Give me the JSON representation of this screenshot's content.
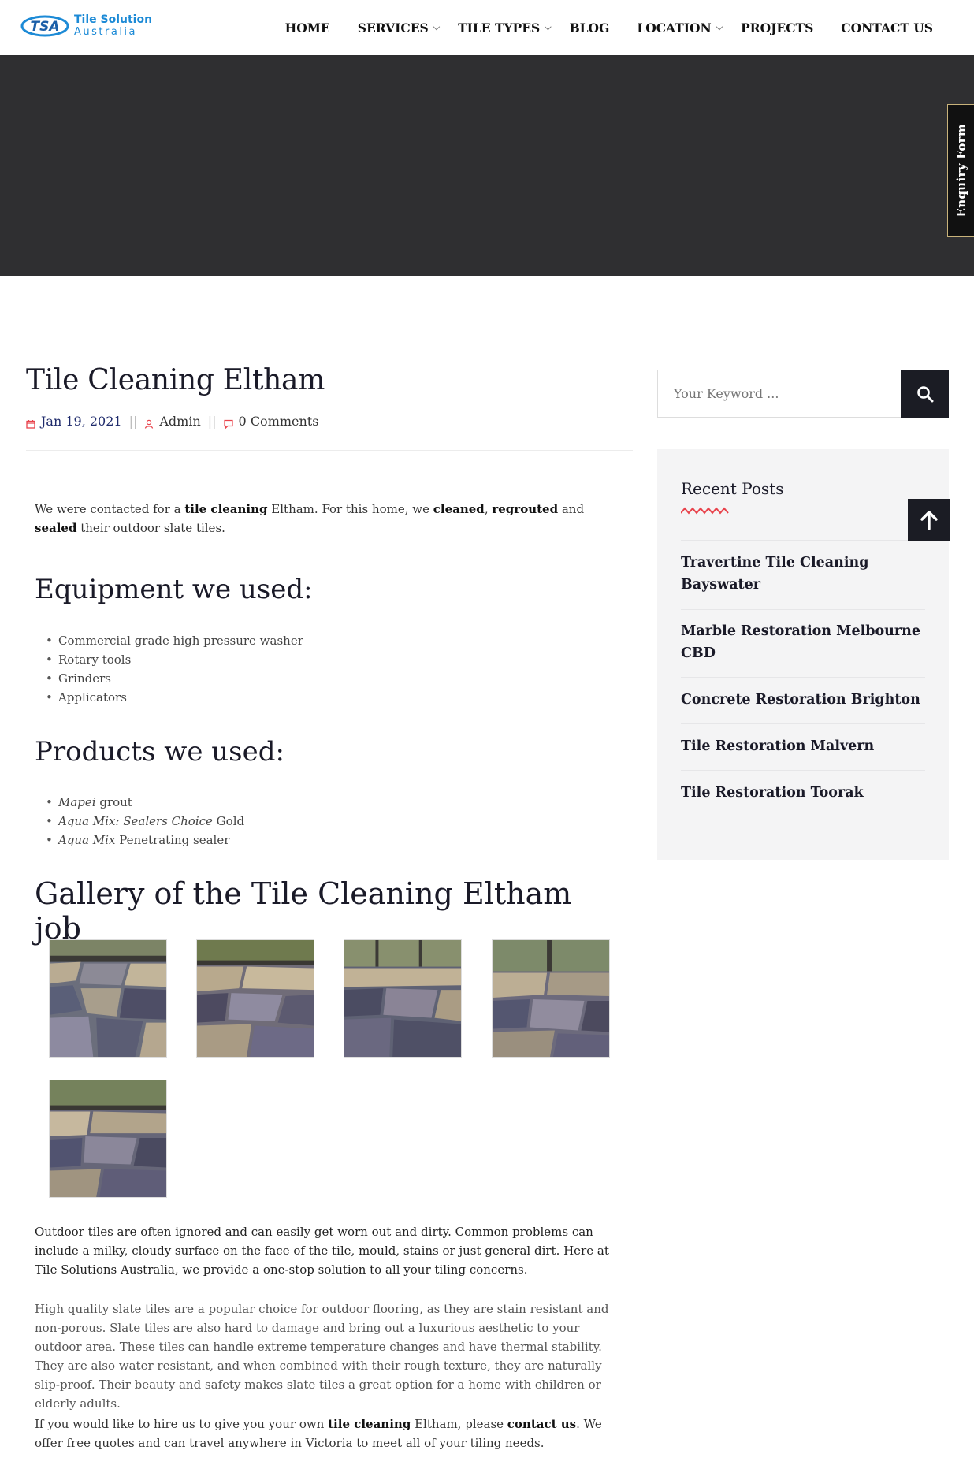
{
  "logo": {
    "abbr": "TSA",
    "line1": "Tile Solution",
    "line2": "Australia"
  },
  "nav": {
    "items": [
      {
        "label": "HOME",
        "dropdown": false
      },
      {
        "label": "SERVICES",
        "dropdown": true
      },
      {
        "label": "TILE TYPES",
        "dropdown": true
      },
      {
        "label": "BLOG",
        "dropdown": false
      },
      {
        "label": "LOCATION",
        "dropdown": true
      },
      {
        "label": "PROJECTS",
        "dropdown": false
      },
      {
        "label": "CONTACT US",
        "dropdown": false
      }
    ]
  },
  "enquiry_tab": "Enquiry Form",
  "post": {
    "title": "Tile Cleaning Eltham",
    "date": "Jan 19, 2021",
    "author": "Admin",
    "comments": "0 Comments",
    "intro": {
      "t1": "We were contacted for a ",
      "b1": "tile cleaning",
      "t2": " Eltham. For this home, we ",
      "b2": "cleaned",
      "t3": ", ",
      "b3": "regrouted",
      "t4": " and ",
      "b4": "sealed",
      "t5": " their outdoor slate tiles."
    },
    "equipment_heading": "Equipment we used:",
    "equipment": [
      "Commercial grade high pressure washer",
      "Rotary tools",
      "Grinders",
      "Applicators"
    ],
    "products_heading": "Products we used:",
    "products": [
      {
        "italic": "Mapei",
        "rest": " grout"
      },
      {
        "italic": "Aqua Mix: Sealers Choice",
        "rest": " Gold"
      },
      {
        "italic": "Aqua Mix",
        "rest": " Penetrating sealer"
      }
    ],
    "gallery_heading": "Gallery of the Tile Cleaning Eltham job",
    "para1": "Outdoor tiles are often ignored and can easily get worn out and dirty. Common problems can include a milky, cloudy surface on the face of the tile, mould, stains or just general dirt. Here at Tile Solutions Australia, we provide a one-stop solution to all your tiling concerns.",
    "para2": "High quality slate tiles are a popular choice for outdoor flooring, as they are stain resistant and non-porous. Slate tiles are also hard to damage and bring out a luxurious aesthetic to your outdoor area. These tiles can handle extreme temperature changes and have thermal stability. They are also water resistant, and when combined with their rough texture, they are naturally slip-proof. Their beauty and safety makes slate tiles a great option for a home with children or elderly adults.",
    "para3": {
      "t1": "If you would like to hire us to give you your own ",
      "b1": "tile cleaning",
      "t2": " Eltham, please ",
      "b2": "contact us",
      "t3": ". We offer free quotes and can travel anywhere in Victoria to meet all of your tiling needs."
    }
  },
  "search": {
    "placeholder": "Your Keyword ..."
  },
  "recent_posts": {
    "title": "Recent Posts",
    "items": [
      "Travertine Tile Cleaning Bayswater",
      "Marble Restoration Melbourne CBD",
      "Concrete Restoration Brighton",
      "Tile Restoration Malvern",
      "Tile Restoration Toorak"
    ]
  },
  "colors": {
    "accent": "#e8424b",
    "dark": "#1b1c24",
    "hero": "#2f2f31",
    "brand": "#1c8ad6"
  }
}
